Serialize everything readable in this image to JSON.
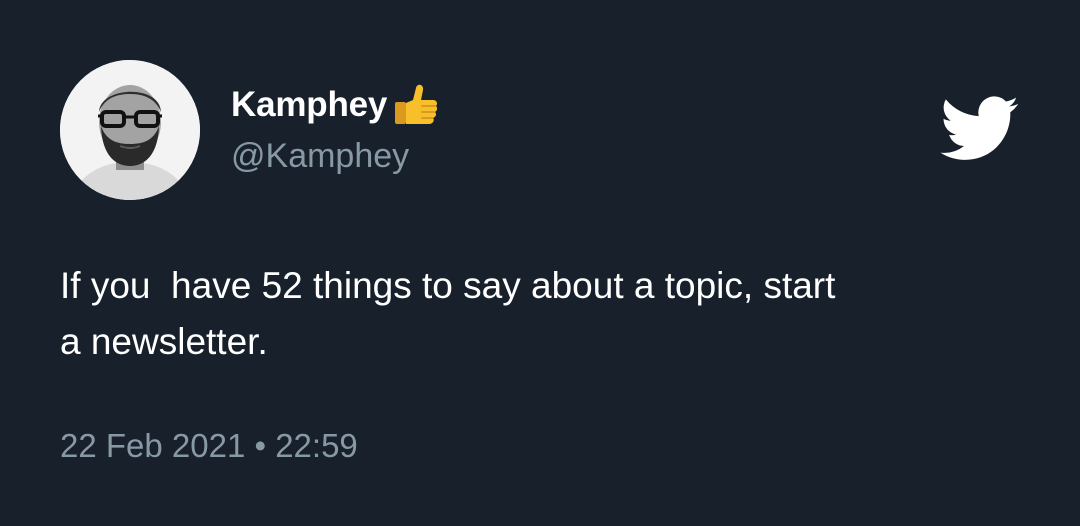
{
  "author": {
    "display_name": "Kamphey",
    "handle": "@Kamphey",
    "badge_icon": "thumbs-up-emoji",
    "avatar": "profile-photo"
  },
  "platform_icon": "twitter-bird-icon",
  "tweet": {
    "text": "If you  have 52 things to say about a topic, start\na newsletter.",
    "timestamp": "22 Feb 2021 • 22:59"
  },
  "colors": {
    "background": "#17202b",
    "primary_text": "#ffffff",
    "secondary_text": "#8899a6",
    "emoji_yellow": "#f7c02b"
  }
}
